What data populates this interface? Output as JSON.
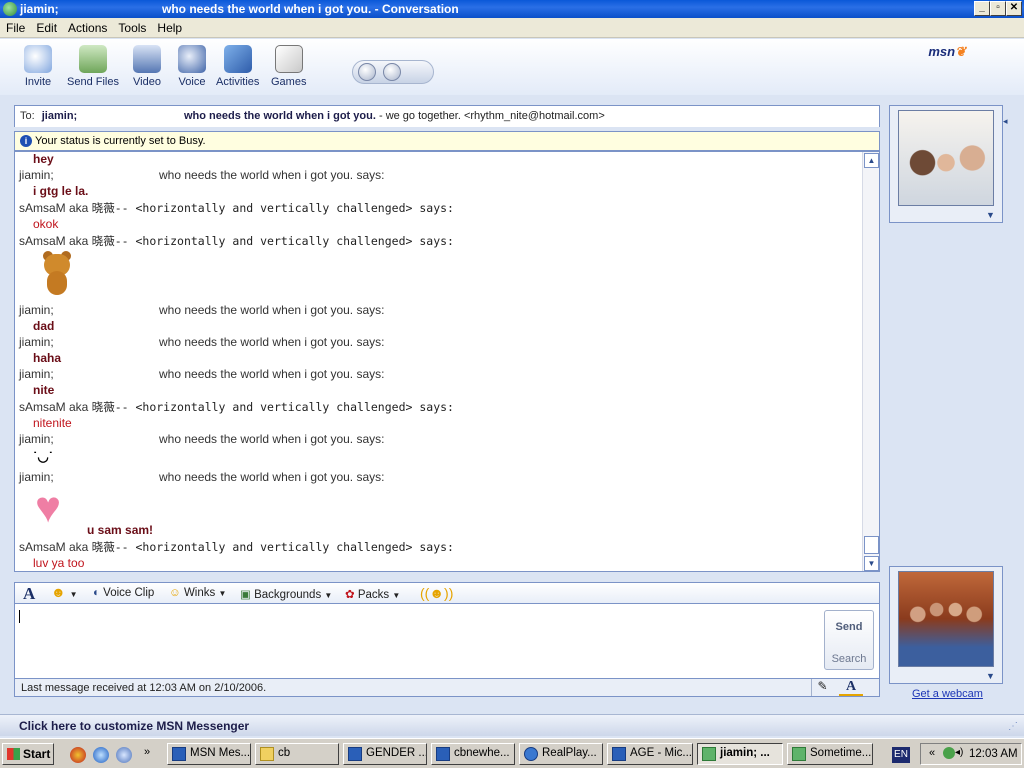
{
  "window": {
    "title_contact": "jiamin;",
    "title_text": "who needs the world when i got you. - Conversation",
    "minimize": "_",
    "maximize": "▫",
    "close": "✕"
  },
  "menu": [
    "File",
    "Edit",
    "Actions",
    "Tools",
    "Help"
  ],
  "toolbar": {
    "buttons": [
      {
        "label": "Invite",
        "icon": "invite-icon"
      },
      {
        "label": "Send Files",
        "icon": "send-files-icon"
      },
      {
        "label": "Video",
        "icon": "video-icon"
      },
      {
        "label": "Voice",
        "icon": "voice-icon"
      },
      {
        "label": "Activities",
        "icon": "activities-icon"
      },
      {
        "label": "Games",
        "icon": "games-icon"
      }
    ],
    "brand": "msn"
  },
  "to_bar": {
    "label": "To:",
    "contact": "jiamin;",
    "display_name": "who needs the world when i got you.",
    "personal_message": "- we go together. <rhythm_nite@hotmail.com>"
  },
  "notice": "Your status is currently set to Busy.",
  "messages": [
    {
      "type": "bold",
      "text": "hey"
    },
    {
      "type": "header_j",
      "name": "jiamin;",
      "says": "who needs the world when i got you. says:"
    },
    {
      "type": "bold",
      "text": "i gtg le la."
    },
    {
      "type": "header_s",
      "name": "sAmsaM aka",
      "tail": "晓薇-- <horizontally and vertically challenged> says:"
    },
    {
      "type": "red",
      "text": "okok"
    },
    {
      "type": "header_s",
      "name": "sAmsaM aka",
      "tail": "晓薇-- <horizontally and vertically challenged> says:"
    },
    {
      "type": "emoticon",
      "icon": "teddy-bear-icon"
    },
    {
      "type": "header_j",
      "name": "jiamin;",
      "says": "who needs the world when i got you. says:"
    },
    {
      "type": "bold",
      "text": "dad"
    },
    {
      "type": "header_j",
      "name": "jiamin;",
      "says": "who needs the world when i got you. says:"
    },
    {
      "type": "bold",
      "text": "haha"
    },
    {
      "type": "header_j",
      "name": "jiamin;",
      "says": "who needs the world when i got you. says:"
    },
    {
      "type": "bold",
      "text": "nite"
    },
    {
      "type": "header_s",
      "name": "sAmsaM aka",
      "tail": "晓薇-- <horizontally and vertically challenged> says:"
    },
    {
      "type": "red",
      "text": "nitenite"
    },
    {
      "type": "header_j",
      "name": "jiamin;",
      "says": "who needs the world when i got you. says:"
    },
    {
      "type": "emoticon",
      "icon": "wink-face-icon"
    },
    {
      "type": "header_j",
      "name": "jiamin;",
      "says": "who needs the world when i got you. says:"
    },
    {
      "type": "emoticon",
      "icon": "heart-icon"
    },
    {
      "type": "bold",
      "text": "u sam sam!"
    },
    {
      "type": "header_s",
      "name": "sAmsaM aka",
      "tail": "晓薇-- <horizontally and vertically challenged> says:"
    },
    {
      "type": "red",
      "text": "luv ya too"
    }
  ],
  "format_bar": {
    "font_icon": "font-icon",
    "emoticon_icon": "smiley-icon",
    "voice_clip": "Voice Clip",
    "winks": "Winks",
    "backgrounds": "Backgrounds",
    "packs": "Packs",
    "nudge_icon": "nudge-icon"
  },
  "compose": {
    "send": "Send",
    "search": "Search"
  },
  "status_line": "Last message received at 12:03 AM on 2/10/2006.",
  "sidebar": {
    "webcam_link": "Get a webcam"
  },
  "customize": "Click here to customize MSN Messenger",
  "taskbar": {
    "start": "Start",
    "tasks": [
      {
        "label": "MSN Mes...",
        "active": false
      },
      {
        "label": "cb",
        "active": false
      },
      {
        "label": "GENDER ...",
        "active": false
      },
      {
        "label": "cbnewhe...",
        "active": false
      },
      {
        "label": "RealPlay...",
        "active": false
      },
      {
        "label": "AGE - Mic...",
        "active": false
      },
      {
        "label": "jiamin; ...",
        "active": true
      },
      {
        "label": "Sometime...",
        "active": false
      }
    ],
    "lang": "EN",
    "clock": "12:03 AM"
  },
  "colors": {
    "titlebar": "#0a58d8",
    "bold_msg": "#6a0d17",
    "red_msg": "#c0141c",
    "link": "#1c35b6"
  }
}
